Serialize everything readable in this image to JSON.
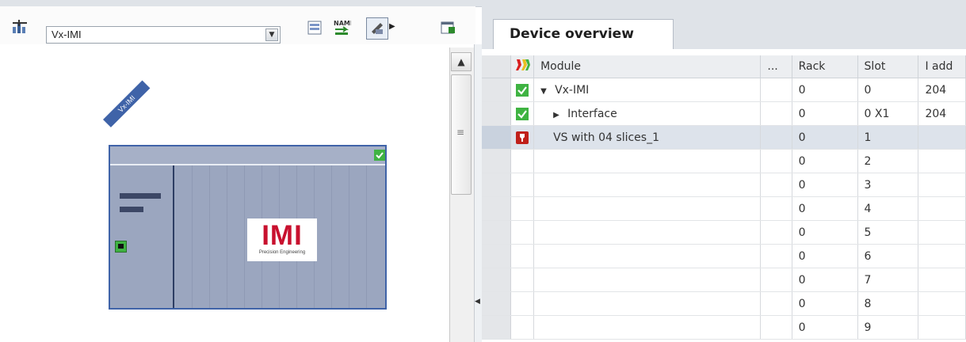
{
  "device_view": {
    "toolbar": {
      "device_select_value": "Vx-IMI",
      "icons": [
        "network-tool-icon",
        "module-list-icon",
        "rename-icon",
        "view-toggle-icon",
        "properties-icon"
      ]
    },
    "device": {
      "tag_label": "Vx-IMI",
      "logo_text": "IMI",
      "logo_subtext": "Precision Engineering"
    }
  },
  "device_overview": {
    "tab_label": "Device overview",
    "columns": {
      "module": "Module",
      "dots": "...",
      "rack": "Rack",
      "slot": "Slot",
      "i_address": "I add"
    },
    "rows": [
      {
        "status": "ok",
        "expand": "down",
        "indent": 0,
        "module": "Vx-IMI",
        "rack": "0",
        "slot": "0",
        "i_address": "204"
      },
      {
        "status": "ok",
        "expand": "right",
        "indent": 1,
        "module": "Interface",
        "rack": "0",
        "slot": "0 X1",
        "i_address": "204"
      },
      {
        "status": "error",
        "expand": "",
        "indent": 1,
        "module": "VS with 04 slices_1",
        "rack": "0",
        "slot": "1",
        "i_address": ""
      },
      {
        "status": "",
        "expand": "",
        "indent": 0,
        "module": "",
        "rack": "0",
        "slot": "2",
        "i_address": ""
      },
      {
        "status": "",
        "expand": "",
        "indent": 0,
        "module": "",
        "rack": "0",
        "slot": "3",
        "i_address": ""
      },
      {
        "status": "",
        "expand": "",
        "indent": 0,
        "module": "",
        "rack": "0",
        "slot": "4",
        "i_address": ""
      },
      {
        "status": "",
        "expand": "",
        "indent": 0,
        "module": "",
        "rack": "0",
        "slot": "5",
        "i_address": ""
      },
      {
        "status": "",
        "expand": "",
        "indent": 0,
        "module": "",
        "rack": "0",
        "slot": "6",
        "i_address": ""
      },
      {
        "status": "",
        "expand": "",
        "indent": 0,
        "module": "",
        "rack": "0",
        "slot": "7",
        "i_address": ""
      },
      {
        "status": "",
        "expand": "",
        "indent": 0,
        "module": "",
        "rack": "0",
        "slot": "8",
        "i_address": ""
      },
      {
        "status": "",
        "expand": "",
        "indent": 0,
        "module": "",
        "rack": "0",
        "slot": "9",
        "i_address": ""
      }
    ]
  },
  "colors": {
    "ok": "#3fb342",
    "error": "#c0201a",
    "device_border": "#3f63a8",
    "device_fill": "#9ba6bf"
  }
}
